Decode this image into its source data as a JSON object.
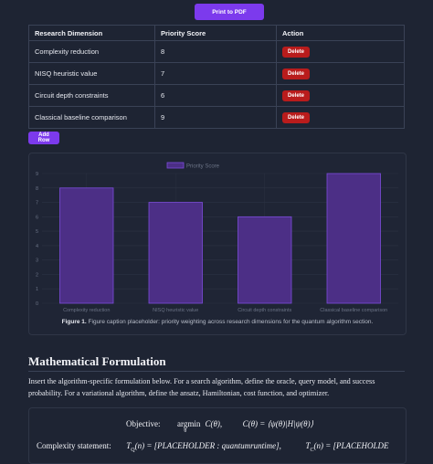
{
  "toolbar": {
    "print_label": "Print to PDF"
  },
  "table": {
    "headers": [
      "Research Dimension",
      "Priority Score",
      "Action"
    ],
    "rows": [
      {
        "dimension": "Complexity reduction",
        "score": "8",
        "action": "Delete"
      },
      {
        "dimension": "NISQ heuristic value",
        "score": "7",
        "action": "Delete"
      },
      {
        "dimension": "Circuit depth constraints",
        "score": "6",
        "action": "Delete"
      },
      {
        "dimension": "Classical baseline comparison",
        "score": "9",
        "action": "Delete"
      }
    ],
    "add_row_label": "Add Row"
  },
  "chart_data": {
    "type": "bar",
    "categories": [
      "Complexity reduction",
      "NISQ heuristic value",
      "Circuit depth constraints",
      "Classical baseline comparison"
    ],
    "series": [
      {
        "name": "Priority Score",
        "values": [
          8,
          7,
          6,
          9
        ]
      }
    ],
    "ylim": [
      0,
      9
    ],
    "yticks": [
      "0",
      "1",
      "2",
      "3",
      "4",
      "5",
      "6",
      "7",
      "8",
      "9"
    ],
    "legend_position": "top",
    "grid": true,
    "colors": {
      "bar_fill": "#4c2f86",
      "bar_stroke": "#7c4ddb",
      "grid": "#2c3344",
      "tick": "#6b7386"
    }
  },
  "caption": {
    "label": "Figure 1.",
    "text": " Figure caption placeholder: priority weighting across research dimensions for the quantum algorithm section."
  },
  "math": {
    "title": "Mathematical Formulation",
    "paragraph": "Insert the algorithm-specific formulation below. For a search algorithm, define the oracle, query model, and success probability. For a variational algorithm, define the ansatz, Hamiltonian, cost function, and optimizer.",
    "objective_label": "Objective:",
    "objective_argmin": "argmin",
    "objective_sub": "θ",
    "objective_expr": " C(θ),",
    "objective_def": "C(θ) = ⟨ψ(θ)|H|ψ(θ)⟩",
    "complexity_label": "Complexity statement:",
    "complexity_q": "T",
    "complexity_q_sub": "Q",
    "complexity_q_expr": "(n) = [PLACEHOLDER : quantumruntime],",
    "complexity_c": "T",
    "complexity_c_sub": "C",
    "complexity_c_expr": "(n) = [PLACEHOLDE"
  },
  "colors": {
    "background": "#1e2433",
    "accent": "#7c3aed",
    "danger": "#b91c1c"
  }
}
